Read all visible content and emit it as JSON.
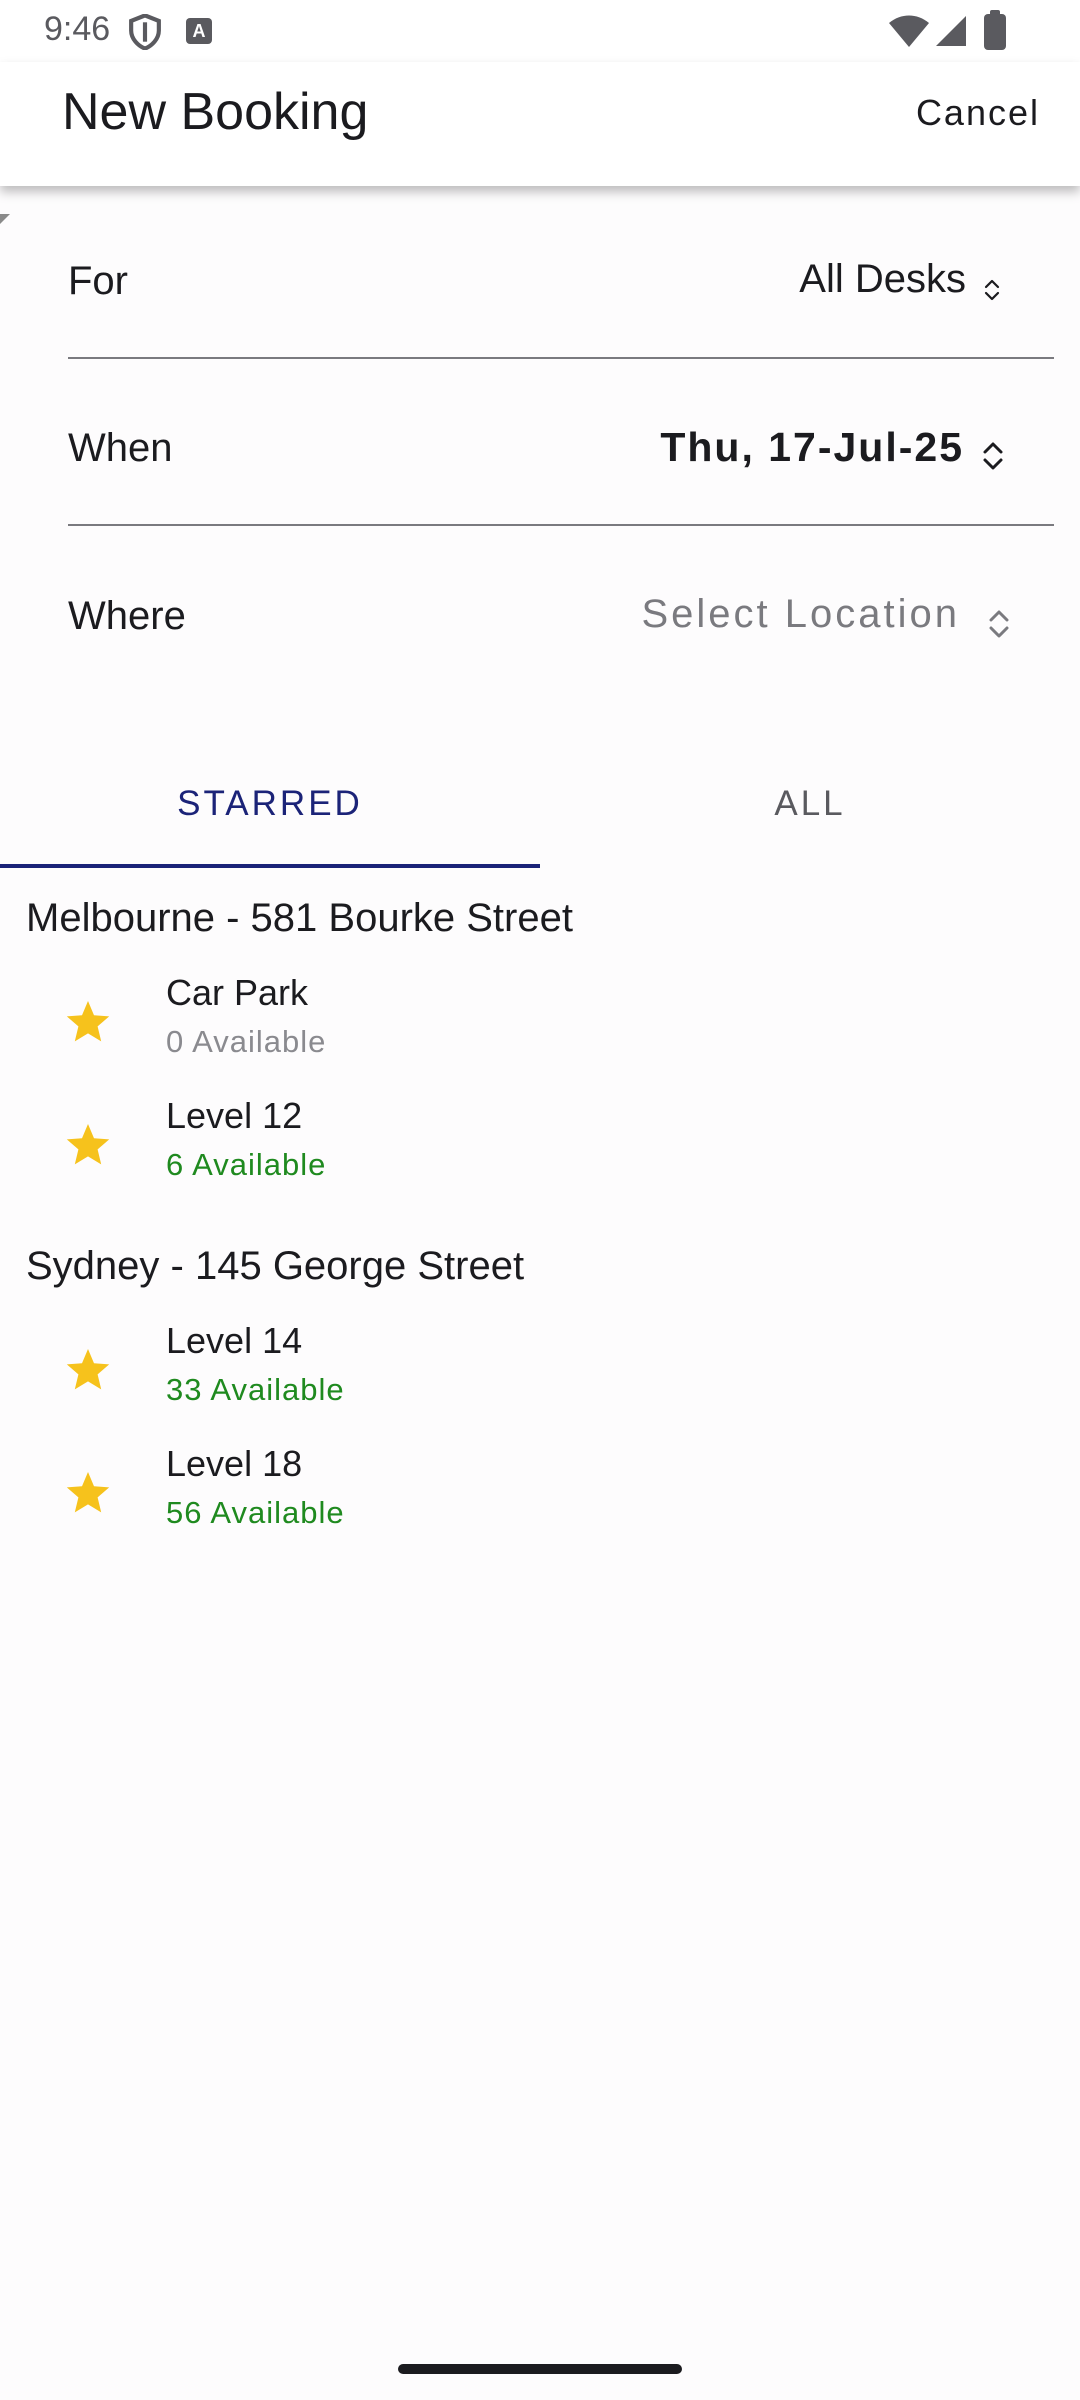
{
  "status_bar": {
    "time": "9:46",
    "a_badge": "A"
  },
  "app_bar": {
    "title": "New Booking",
    "cancel_label": "Cancel"
  },
  "form": {
    "for": {
      "label": "For",
      "value": "All Desks"
    },
    "when": {
      "label": "When",
      "value": "Thu, 17-Jul-25"
    },
    "where": {
      "label": "Where",
      "value": "Select Location"
    }
  },
  "tabs": {
    "starred": "STARRED",
    "all": "ALL",
    "active": "STARRED"
  },
  "groups": [
    {
      "title": "Melbourne - 581 Bourke Street",
      "items": [
        {
          "name": "Car Park",
          "availability": "0 Available"
        },
        {
          "name": "Level 12",
          "availability": "6 Available"
        }
      ]
    },
    {
      "title": "Sydney - 145 George Street",
      "items": [
        {
          "name": "Level 14",
          "availability": "33 Available"
        },
        {
          "name": "Level 18",
          "availability": "56 Available"
        }
      ]
    }
  ],
  "colors": {
    "accent": "#1b2378",
    "available": "#1f8a1f",
    "unavailable": "#8a8a8f",
    "star": "#f6c21c"
  },
  "icons": [
    "shield-icon",
    "wifi-icon",
    "signal-icon",
    "battery-icon",
    "chevron-updown-icon",
    "star-icon"
  ]
}
